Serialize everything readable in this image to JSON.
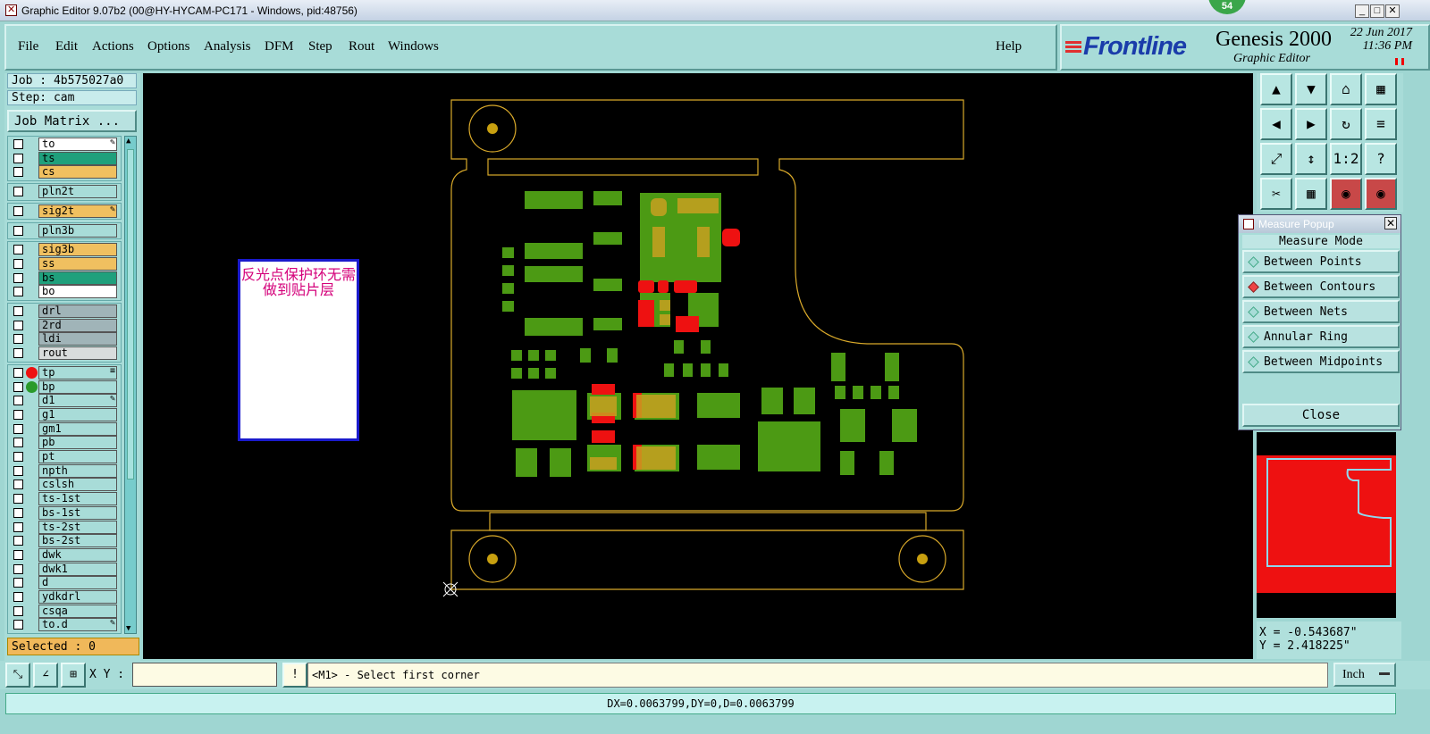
{
  "window": {
    "title": "Graphic Editor 9.07b2 (00@HY-HYCAM-PC171 - Windows, pid:48756)",
    "badge": "54"
  },
  "menu": [
    "File",
    "Edit",
    "Actions",
    "Options",
    "Analysis",
    "DFM",
    "Step",
    "Rout",
    "Windows"
  ],
  "help": "Help",
  "brand": {
    "logo": "Frontline",
    "product": "Genesis 2000",
    "subtitle": "Graphic Editor",
    "date": "22 Jun 2017",
    "time": "11:36 PM"
  },
  "job": {
    "job": "Job : 4b575027a0",
    "step": "Step: cam",
    "matrix": "Job Matrix ..."
  },
  "layers": [
    {
      "name": "to",
      "color": "#ffffff",
      "mark": "✎"
    },
    {
      "name": "ts",
      "color": "#1fa07c"
    },
    {
      "name": "cs",
      "color": "#f0c060"
    },
    {
      "name": "pln2t",
      "color": "#a8dcd8"
    },
    {
      "name": "sig2t",
      "color": "#f0c060",
      "mark": "✎"
    },
    {
      "name": "pln3b",
      "color": "#a8dcd8"
    },
    {
      "name": "sig3b",
      "color": "#f0c060"
    },
    {
      "name": "ss",
      "color": "#f0c060"
    },
    {
      "name": "bs",
      "color": "#1fa07c"
    },
    {
      "name": "bo",
      "color": "#ffffff"
    },
    {
      "name": "drl",
      "color": "#a0b4b8"
    },
    {
      "name": "2rd",
      "color": "#a0b4b8"
    },
    {
      "name": "ldi",
      "color": "#a0b4b8"
    },
    {
      "name": "rout",
      "color": "#d8dcdc"
    },
    {
      "name": "tp",
      "color": "#a8dcd8",
      "dot": "#ee1111",
      "mark": "≡"
    },
    {
      "name": "bp",
      "color": "#a8dcd8",
      "dot": "#2a9a2a"
    },
    {
      "name": "d1",
      "color": "#a8dcd8",
      "mark": "✎"
    },
    {
      "name": "g1",
      "color": "#a8dcd8"
    },
    {
      "name": "gm1",
      "color": "#a8dcd8"
    },
    {
      "name": "pb",
      "color": "#a8dcd8"
    },
    {
      "name": "pt",
      "color": "#a8dcd8"
    },
    {
      "name": "npth",
      "color": "#a8dcd8"
    },
    {
      "name": "cslsh",
      "color": "#a8dcd8"
    },
    {
      "name": "ts-1st",
      "color": "#a8dcd8"
    },
    {
      "name": "bs-1st",
      "color": "#a8dcd8"
    },
    {
      "name": "ts-2st",
      "color": "#a8dcd8"
    },
    {
      "name": "bs-2st",
      "color": "#a8dcd8"
    },
    {
      "name": "dwk",
      "color": "#a8dcd8"
    },
    {
      "name": "dwk1",
      "color": "#a8dcd8"
    },
    {
      "name": "d",
      "color": "#a8dcd8"
    },
    {
      "name": "ydkdrl",
      "color": "#a8dcd8"
    },
    {
      "name": "csqa",
      "color": "#a8dcd8"
    },
    {
      "name": "to.d",
      "color": "#a8dcd8",
      "mark": "✎"
    }
  ],
  "selected": "Selected : 0",
  "note": "反光点保护环无需做到贴片层",
  "measure": {
    "title": "Measure Popup",
    "mode_label": "Measure Mode",
    "options": [
      {
        "label": "Between Points",
        "active": false
      },
      {
        "label": "Between Contours",
        "active": true
      },
      {
        "label": "Between Nets",
        "active": false
      },
      {
        "label": "Annular Ring",
        "active": false
      },
      {
        "label": "Between Midpoints",
        "active": false
      }
    ],
    "close": "Close"
  },
  "coords": {
    "x": "X = -0.543687\"",
    "y": "Y = 2.418225\""
  },
  "xy_label": "X Y :",
  "message": "<M1> - Select first corner",
  "unit": "Inch",
  "status": "DX=0.0063799,DY=0,D=0.0063799",
  "tools": [
    "▲",
    "▼",
    "⌂",
    "▦",
    "◀",
    "▶",
    "↻",
    "≡",
    "⤢",
    "↕",
    "1:2",
    "?",
    "✂",
    "▦",
    "◉",
    "◉"
  ]
}
